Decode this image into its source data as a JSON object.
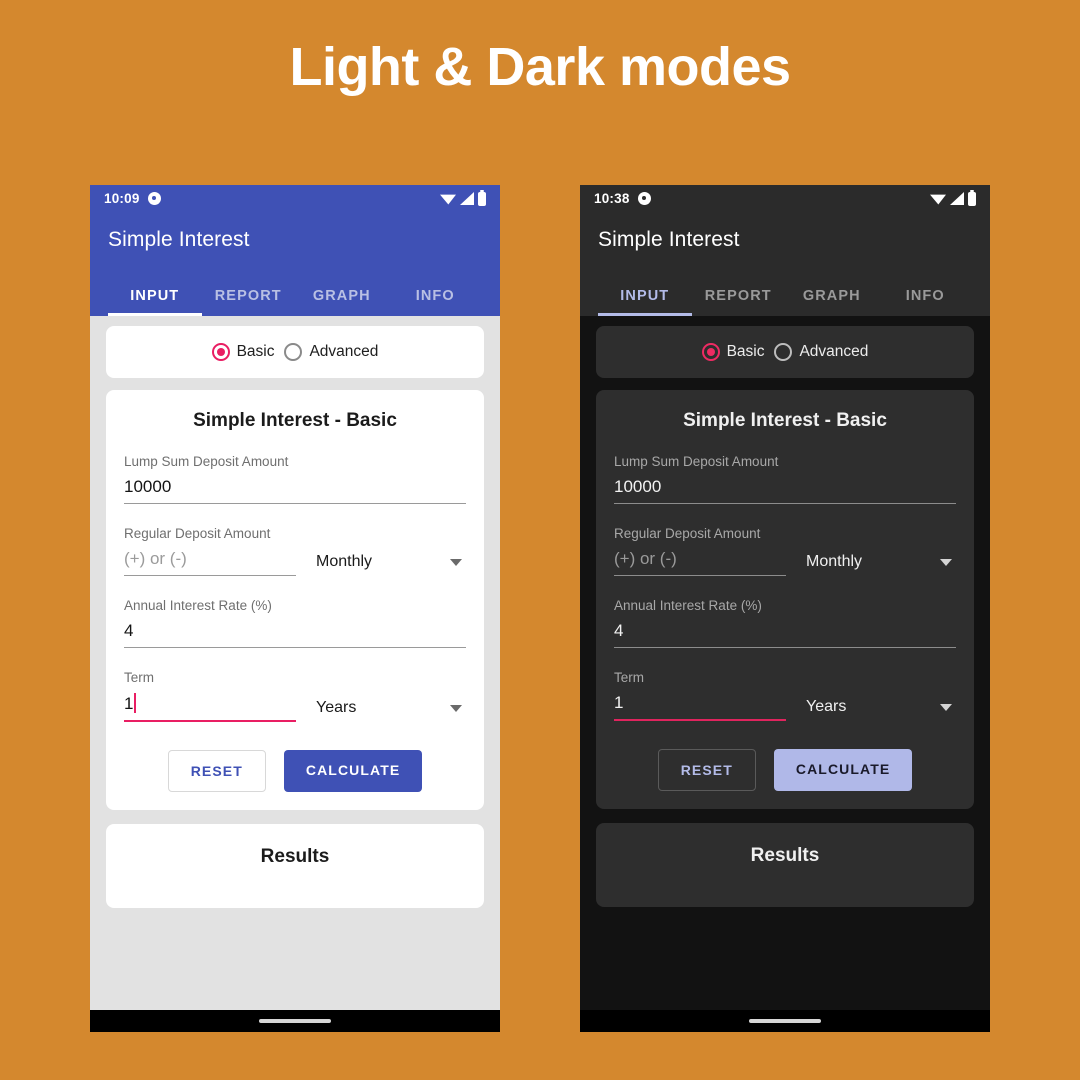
{
  "banner": {
    "headline": "Light & Dark modes",
    "background_color": "#d4882e",
    "text_color": "#ffffff"
  },
  "phones": [
    {
      "theme": "light",
      "accent_color": "#3f51b5",
      "radio_color": "#e91e63",
      "status_bar": {
        "time": "10:09",
        "icons": [
          "alarm-dot-icon",
          "wifi-icon",
          "signal-icon",
          "battery-icon"
        ]
      },
      "app_bar": {
        "title": "Simple Interest"
      },
      "tabs": [
        {
          "label": "INPUT",
          "active": true
        },
        {
          "label": "REPORT",
          "active": false
        },
        {
          "label": "GRAPH",
          "active": false
        },
        {
          "label": "INFO",
          "active": false
        }
      ],
      "mode_selector": {
        "options": [
          {
            "label": "Basic",
            "selected": true
          },
          {
            "label": "Advanced",
            "selected": false
          }
        ]
      },
      "form": {
        "title": "Simple Interest - Basic",
        "fields": [
          {
            "label": "Lump Sum Deposit Amount",
            "value": "10000",
            "placeholder": "",
            "focused": false,
            "has_select": false
          },
          {
            "label": "Regular Deposit Amount",
            "value": "",
            "placeholder": "(+) or (-)",
            "focused": false,
            "has_select": true,
            "select_value": "Monthly"
          },
          {
            "label": "Annual Interest Rate (%)",
            "value": "4",
            "placeholder": "",
            "focused": false,
            "has_select": false
          },
          {
            "label": "Term",
            "value": "1",
            "placeholder": "",
            "focused": true,
            "has_select": true,
            "select_value": "Years"
          }
        ],
        "buttons": {
          "reset": "RESET",
          "calculate": "CALCULATE"
        }
      },
      "results": {
        "title": "Results"
      }
    },
    {
      "theme": "dark",
      "accent_color": "#b0b8e8",
      "radio_color": "#ef2b63",
      "status_bar": {
        "time": "10:38",
        "icons": [
          "alarm-dot-icon",
          "wifi-icon",
          "signal-icon",
          "battery-icon"
        ]
      },
      "app_bar": {
        "title": "Simple Interest"
      },
      "tabs": [
        {
          "label": "INPUT",
          "active": true
        },
        {
          "label": "REPORT",
          "active": false
        },
        {
          "label": "GRAPH",
          "active": false
        },
        {
          "label": "INFO",
          "active": false
        }
      ],
      "mode_selector": {
        "options": [
          {
            "label": "Basic",
            "selected": true
          },
          {
            "label": "Advanced",
            "selected": false
          }
        ]
      },
      "form": {
        "title": "Simple Interest - Basic",
        "fields": [
          {
            "label": "Lump Sum Deposit Amount",
            "value": "10000",
            "placeholder": "",
            "focused": false,
            "has_select": false
          },
          {
            "label": "Regular Deposit Amount",
            "value": "",
            "placeholder": "(+) or (-)",
            "focused": false,
            "has_select": true,
            "select_value": "Monthly"
          },
          {
            "label": "Annual Interest Rate (%)",
            "value": "4",
            "placeholder": "",
            "focused": false,
            "has_select": false
          },
          {
            "label": "Term",
            "value": "1",
            "placeholder": "",
            "focused": true,
            "has_select": true,
            "select_value": "Years"
          }
        ],
        "buttons": {
          "reset": "RESET",
          "calculate": "CALCULATE"
        }
      },
      "results": {
        "title": "Results"
      }
    }
  ]
}
